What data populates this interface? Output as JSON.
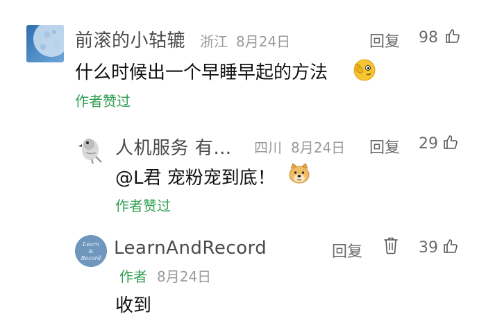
{
  "comments": [
    {
      "username": "前滚的小轱辘",
      "location": "浙江",
      "date": "8月24日",
      "reply_label": "回复",
      "likes": "98",
      "text": "什么时候出一个早睡早起的方法",
      "emoji_icon": "facepalm-peek-emoji",
      "author_liked": "作者赞过"
    },
    {
      "username": "人机服务 有…",
      "location": "四川",
      "date": "8月24日",
      "reply_label": "回复",
      "likes": "29",
      "text": "@L君 宠粉宠到底！",
      "emoji_icon": "doge-emoji",
      "author_liked": "作者赞过"
    },
    {
      "username": "LearnAndRecord",
      "author_tag": "作者",
      "date": "8月24日",
      "reply_label": "回复",
      "likes": "39",
      "text": "收到",
      "avatar_text": "Learn & Record"
    }
  ],
  "colors": {
    "accent_green": "#2e9e4f",
    "meta_gray": "#9a9a9a",
    "name_gray": "#4a4a4a"
  }
}
